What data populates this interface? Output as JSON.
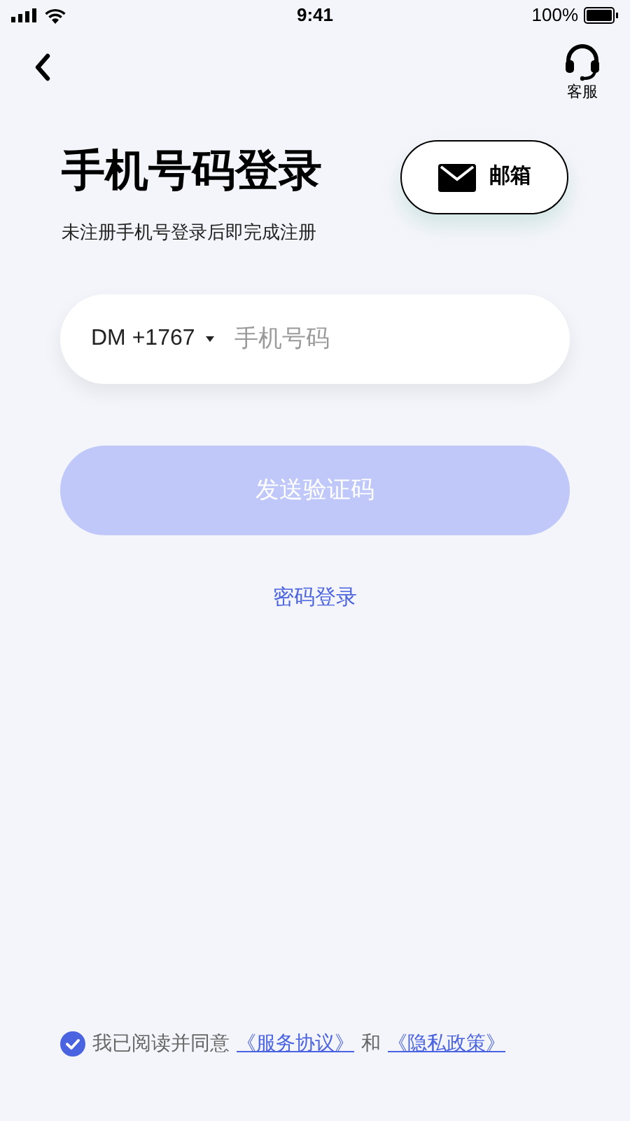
{
  "status_bar": {
    "time": "9:41",
    "battery": "100%"
  },
  "header": {
    "service_label": "客服"
  },
  "title": "手机号码登录",
  "subtitle": "未注册手机号登录后即完成注册",
  "email_button": {
    "label": "邮箱"
  },
  "phone_field": {
    "country_code": "DM +1767",
    "placeholder": "手机号码"
  },
  "send_button": {
    "label": "发送验证码",
    "disabled": true
  },
  "password_login_link": "密码登录",
  "agreement": {
    "checked": true,
    "text": "我已阅读并同意",
    "links": [
      "《服务协议》",
      "和",
      "《隐私政策》"
    ]
  }
}
